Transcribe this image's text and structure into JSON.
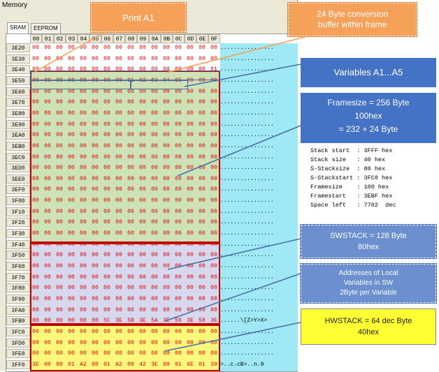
{
  "window": {
    "title": "Memory"
  },
  "tabs": [
    {
      "label": "SRAM",
      "active": true
    },
    {
      "label": "EEPROM",
      "active": false
    }
  ],
  "columns": [
    "00",
    "01",
    "02",
    "03",
    "04",
    "05",
    "06",
    "07",
    "08",
    "09",
    "0A",
    "0B",
    "0C",
    "0D",
    "0E",
    "0F"
  ],
  "rows": [
    {
      "addr": "3E20",
      "ascii": "................"
    },
    {
      "addr": "3E30",
      "ascii": "................"
    },
    {
      "addr": "3E40",
      "ascii": "................"
    },
    {
      "addr": "3E50",
      "ascii": "................"
    },
    {
      "addr": "3E60",
      "ascii": "................"
    },
    {
      "addr": "3E70",
      "ascii": "................"
    },
    {
      "addr": "3E80",
      "ascii": "................"
    },
    {
      "addr": "3E90",
      "ascii": "................"
    },
    {
      "addr": "3EA0",
      "ascii": "................"
    },
    {
      "addr": "3EB0",
      "ascii": "................"
    },
    {
      "addr": "3EC0",
      "ascii": "................"
    },
    {
      "addr": "3ED0",
      "ascii": "................"
    },
    {
      "addr": "3EE0",
      "ascii": "................"
    },
    {
      "addr": "3EF0",
      "ascii": "................"
    },
    {
      "addr": "3F00",
      "ascii": "................"
    },
    {
      "addr": "3F10",
      "ascii": "................"
    },
    {
      "addr": "3F20",
      "ascii": "................"
    },
    {
      "addr": "3F30",
      "ascii": "................"
    },
    {
      "addr": "3F40",
      "ascii": "................"
    },
    {
      "addr": "3F50",
      "ascii": "................"
    },
    {
      "addr": "3F60",
      "ascii": "................"
    },
    {
      "addr": "3F70",
      "ascii": "................"
    },
    {
      "addr": "3F80",
      "ascii": "................"
    },
    {
      "addr": "3F90",
      "ascii": "................"
    },
    {
      "addr": "3FA0",
      "ascii": "................"
    },
    {
      "addr": "3FB0",
      "ascii": "......\\[Z>Y>X>"
    },
    {
      "addr": "3FC0",
      "ascii": "................"
    },
    {
      "addr": "3FD0",
      "ascii": "................"
    },
    {
      "addr": "3FE0",
      "ascii": "................"
    },
    {
      "addr": "3FF0",
      "ascii": ">..c.cB>..n.9"
    }
  ],
  "special_cells": {
    "3E40": {
      "15": "01"
    },
    "3E50": {
      "8": "01",
      "9": "02",
      "10": "03",
      "11": "04",
      "12": "05"
    },
    "3FB0": {
      "6": "5C",
      "7": "3E",
      "8": "5B",
      "9": "3E",
      "10": "5A",
      "11": "3E",
      "12": "59",
      "13": "3E",
      "14": "58",
      "15": "3E"
    },
    "3FF0": {
      "0": "3E",
      "3": "01",
      "4": "A2",
      "6": "01",
      "7": "A2",
      "9": "42",
      "10": "3E",
      "12": "01",
      "13": "6E",
      "14": "01",
      "15": "39"
    }
  },
  "default_byte": "00",
  "callouts": {
    "print": "Print A1",
    "convert": [
      "24 Byte conversion",
      "buffer within frame"
    ],
    "variables": "Variables A1...A5",
    "framesize": [
      "Framesize = 256 Byte",
      "100hex",
      "= 232 + 24  Byte"
    ],
    "swstack": [
      "SWSTACK = 128 Byte",
      "80hex"
    ],
    "addresses": [
      "Addresses of Local",
      "Variables in  SW",
      "2Byte per Variable"
    ],
    "hwstack": [
      "HWSTACK = 64 dec Byte",
      "40hex"
    ]
  },
  "stack_info": [
    {
      "label": "Stack start  ",
      "value": "3FFF hex"
    },
    {
      "label": "Stack size   ",
      "value": "40 hex"
    },
    {
      "label": "S-Stacksize  ",
      "value": "80 hex"
    },
    {
      "label": "S-Stackstart ",
      "value": "3FC0 hex"
    },
    {
      "label": "Framesize    ",
      "value": "100 hex"
    },
    {
      "label": "Framestart   ",
      "value": "3EBF hex"
    },
    {
      "label": "Space left   ",
      "value": "7702  dec"
    }
  ],
  "colors": {
    "byte_text": "#d40000",
    "frame_fill": "#91be5f",
    "swstack_fill": "#afafdc",
    "hwstack_fill": "#fff546",
    "ascii_fill": "#9fe8f5",
    "callout_blue": "#4472c4",
    "callout_orange": "#f6a15a",
    "callout_yellow": "#ffff33"
  }
}
